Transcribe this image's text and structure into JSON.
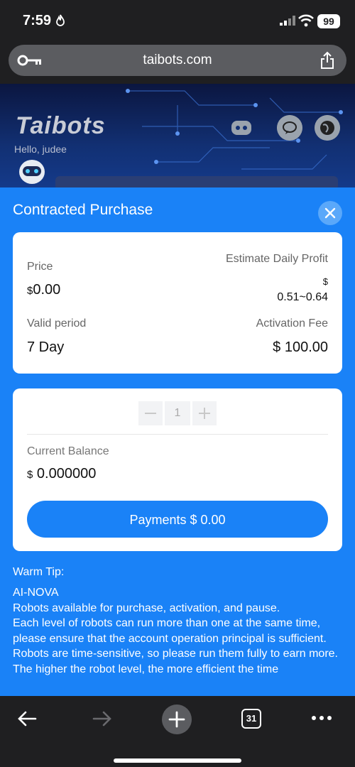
{
  "status_bar": {
    "time": "7:59",
    "battery": "99"
  },
  "browser": {
    "url": "taibots.com",
    "tabs_count": "31"
  },
  "site": {
    "logo": "Taibots",
    "greeting": "Hello, judee"
  },
  "sheet": {
    "title": "Contracted Purchase",
    "price_label": "Price",
    "price_currency": "$",
    "price_value": "0.00",
    "daily_profit_label": "Estimate Daily Profit",
    "daily_profit_currency": "$",
    "daily_profit_value": "0.51~0.64",
    "valid_period_label": "Valid period",
    "valid_period_value": "7 Day",
    "activation_fee_label": "Activation Fee",
    "activation_fee_value": "$ 100.00",
    "quantity": "1",
    "current_balance_label": "Current Balance",
    "current_balance_currency": "$",
    "current_balance_value": "0.000000",
    "payment_button": "Payments $ 0.00",
    "tip_title": "Warm Tip:",
    "tip_body": "AI-NOVA\nRobots available for purchase, activation, and pause.\nEach level of robots can run more than one at the same time, please ensure that the account operation principal is sufficient.\nRobots are time-sensitive, so please run them fully to earn more.\nThe higher the robot level, the more efficient the time"
  }
}
